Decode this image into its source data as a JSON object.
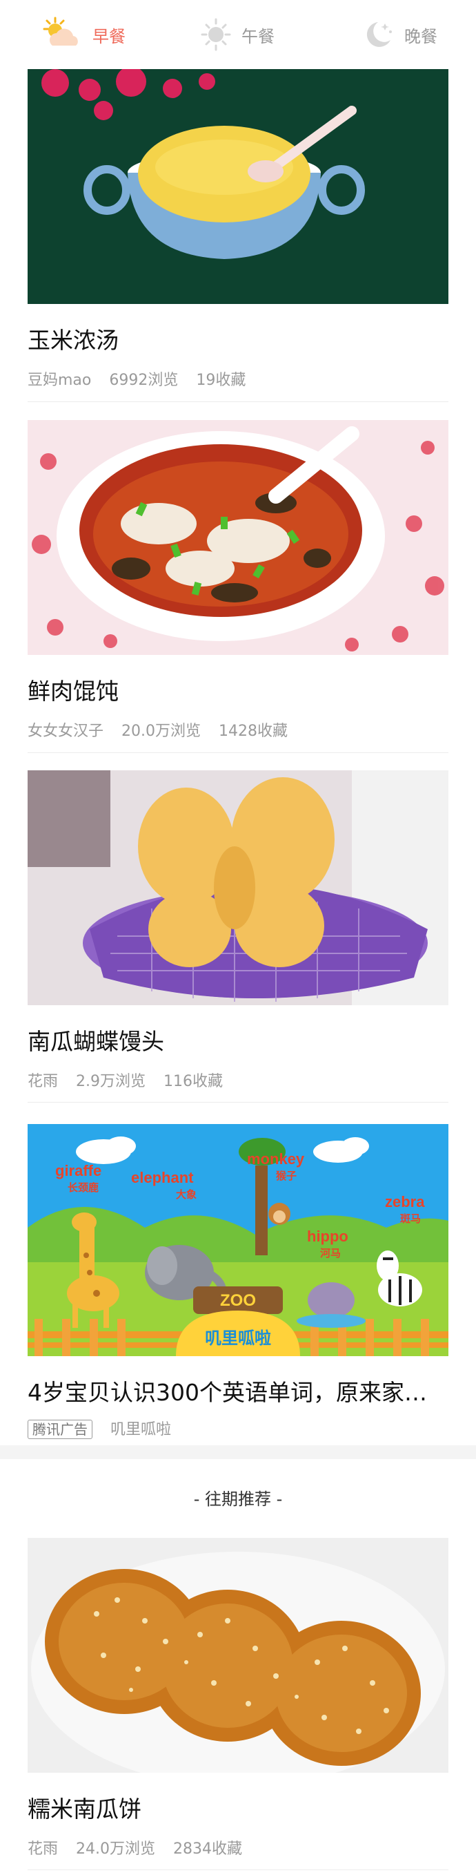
{
  "tabs": [
    {
      "label": "早餐",
      "icon": "sun-cloud-icon",
      "active": true
    },
    {
      "label": "午餐",
      "icon": "sun-icon",
      "active": false
    },
    {
      "label": "晚餐",
      "icon": "moon-stars-icon",
      "active": false
    }
  ],
  "colors": {
    "accent": "#ef6a5a",
    "muted": "#9a9a9a"
  },
  "feed": [
    {
      "title": "玉米浓汤",
      "author": "豆妈mao",
      "views": "6992浏览",
      "favorites": "19收藏"
    },
    {
      "title": "鲜肉馄饨",
      "author": "女女女汉子",
      "views": "20.0万浏览",
      "favorites": "1428收藏"
    },
    {
      "title": "南瓜蝴蝶馒头",
      "author": "花雨",
      "views": "2.9万浏览",
      "favorites": "116收藏"
    }
  ],
  "ad": {
    "title": "4岁宝贝认识300个英语单词，原来家…",
    "tag": "腾讯广告",
    "source": "叽里呱啦",
    "art": {
      "animals": [
        {
          "en": "giraffe",
          "cn": "长颈鹿"
        },
        {
          "en": "elephant",
          "cn": "大象"
        },
        {
          "en": "monkey",
          "cn": "猴子"
        },
        {
          "en": "hippo",
          "cn": "河马"
        },
        {
          "en": "zebra",
          "cn": "斑马"
        }
      ],
      "sign": "ZOO",
      "brand": "叽里呱啦"
    }
  },
  "past": {
    "section_title": "- 往期推荐 -",
    "items": [
      {
        "title": "糯米南瓜饼",
        "author": "花雨",
        "views": "24.0万浏览",
        "favorites": "2834收藏"
      }
    ]
  }
}
